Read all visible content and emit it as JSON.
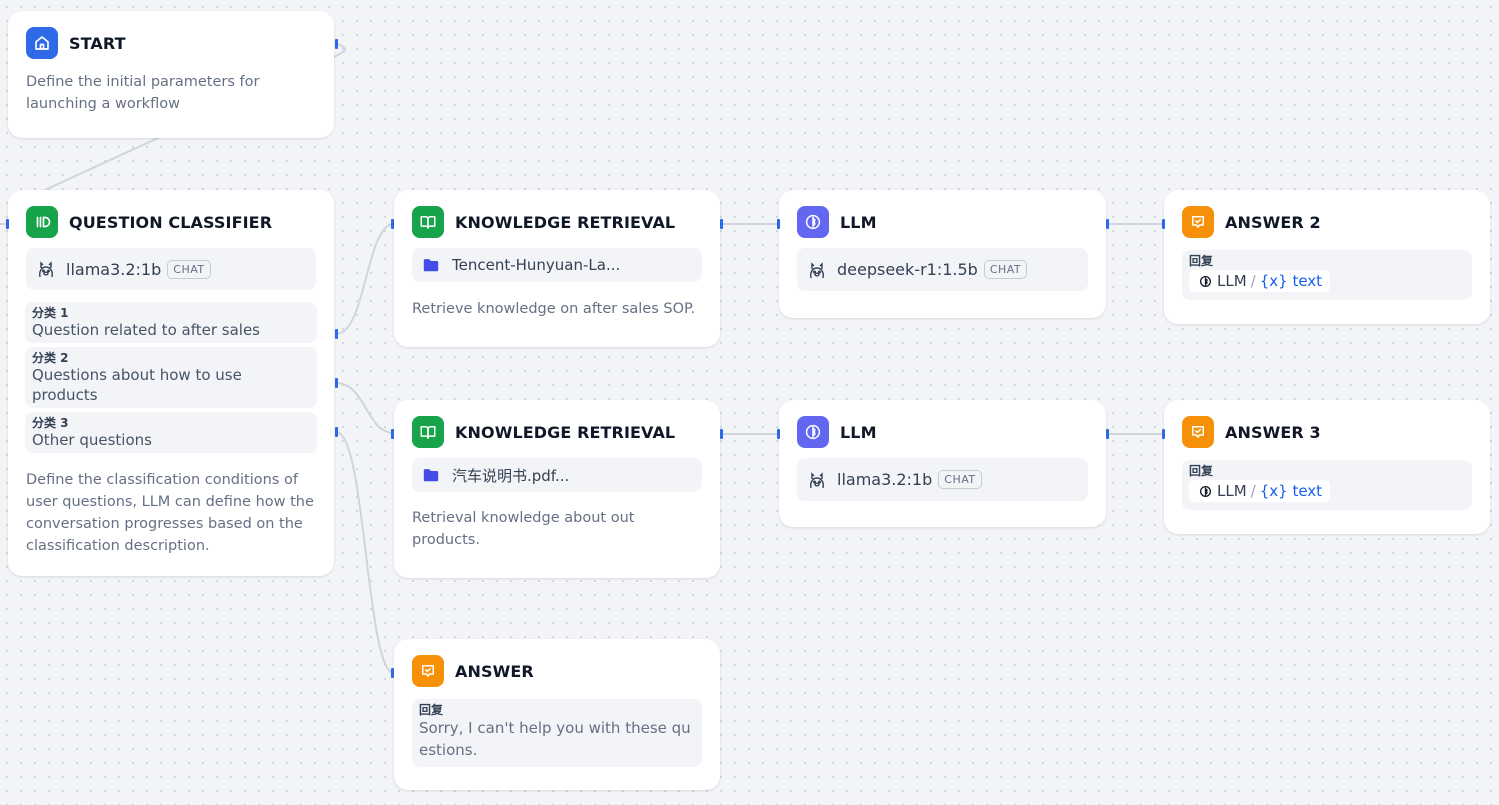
{
  "nodes": {
    "start": {
      "title": "START",
      "desc": "Define the initial parameters for launching a workflow",
      "icon": "home-icon",
      "color": "#2e6ae8"
    },
    "classifier": {
      "title": "QUESTION CLASSIFIER",
      "model": "llama3.2:1b",
      "tag": "CHAT",
      "classes": [
        {
          "label": "分类 1",
          "text": "Question related to after sales"
        },
        {
          "label": "分类 2",
          "text": "Questions about how to use products"
        },
        {
          "label": "分类 3",
          "text": "Other questions"
        }
      ],
      "desc": "Define the classification conditions of user questions, LLM can define how the conversation progresses based on the classification description.",
      "icon": "classifier-icon",
      "color": "#16a34a"
    },
    "kr1": {
      "title": "KNOWLEDGE RETRIEVAL",
      "kb": "Tencent-Hunyuan-La...",
      "desc": "Retrieve knowledge on after sales SOP.",
      "icon": "book-icon",
      "color": "#16a34a"
    },
    "kr2": {
      "title": "KNOWLEDGE RETRIEVAL",
      "kb": "汽车说明书.pdf...",
      "desc": "Retrieval knowledge about out products.",
      "icon": "book-icon",
      "color": "#16a34a"
    },
    "llm1": {
      "title": "LLM",
      "model": "deepseek-r1:1.5b",
      "tag": "CHAT",
      "icon": "llm-icon",
      "color": "#6366f1"
    },
    "llm2": {
      "title": "LLM",
      "model": "llama3.2:1b",
      "tag": "CHAT",
      "icon": "llm-icon",
      "color": "#6366f1"
    },
    "answer2": {
      "title": "ANSWER 2",
      "reply_label": "回复",
      "var_source": "LLM",
      "var_sep": "/",
      "var_name": "{x} text",
      "icon": "answer-icon",
      "color": "#f79009"
    },
    "answer3": {
      "title": "ANSWER 3",
      "reply_label": "回复",
      "var_source": "LLM",
      "var_sep": "/",
      "var_name": "{x} text",
      "icon": "answer-icon",
      "color": "#f79009"
    },
    "answer": {
      "title": "ANSWER",
      "reply_label": "回复",
      "reply_text": "Sorry, I can't help you with these questions.",
      "icon": "answer-icon",
      "color": "#f79009"
    }
  }
}
